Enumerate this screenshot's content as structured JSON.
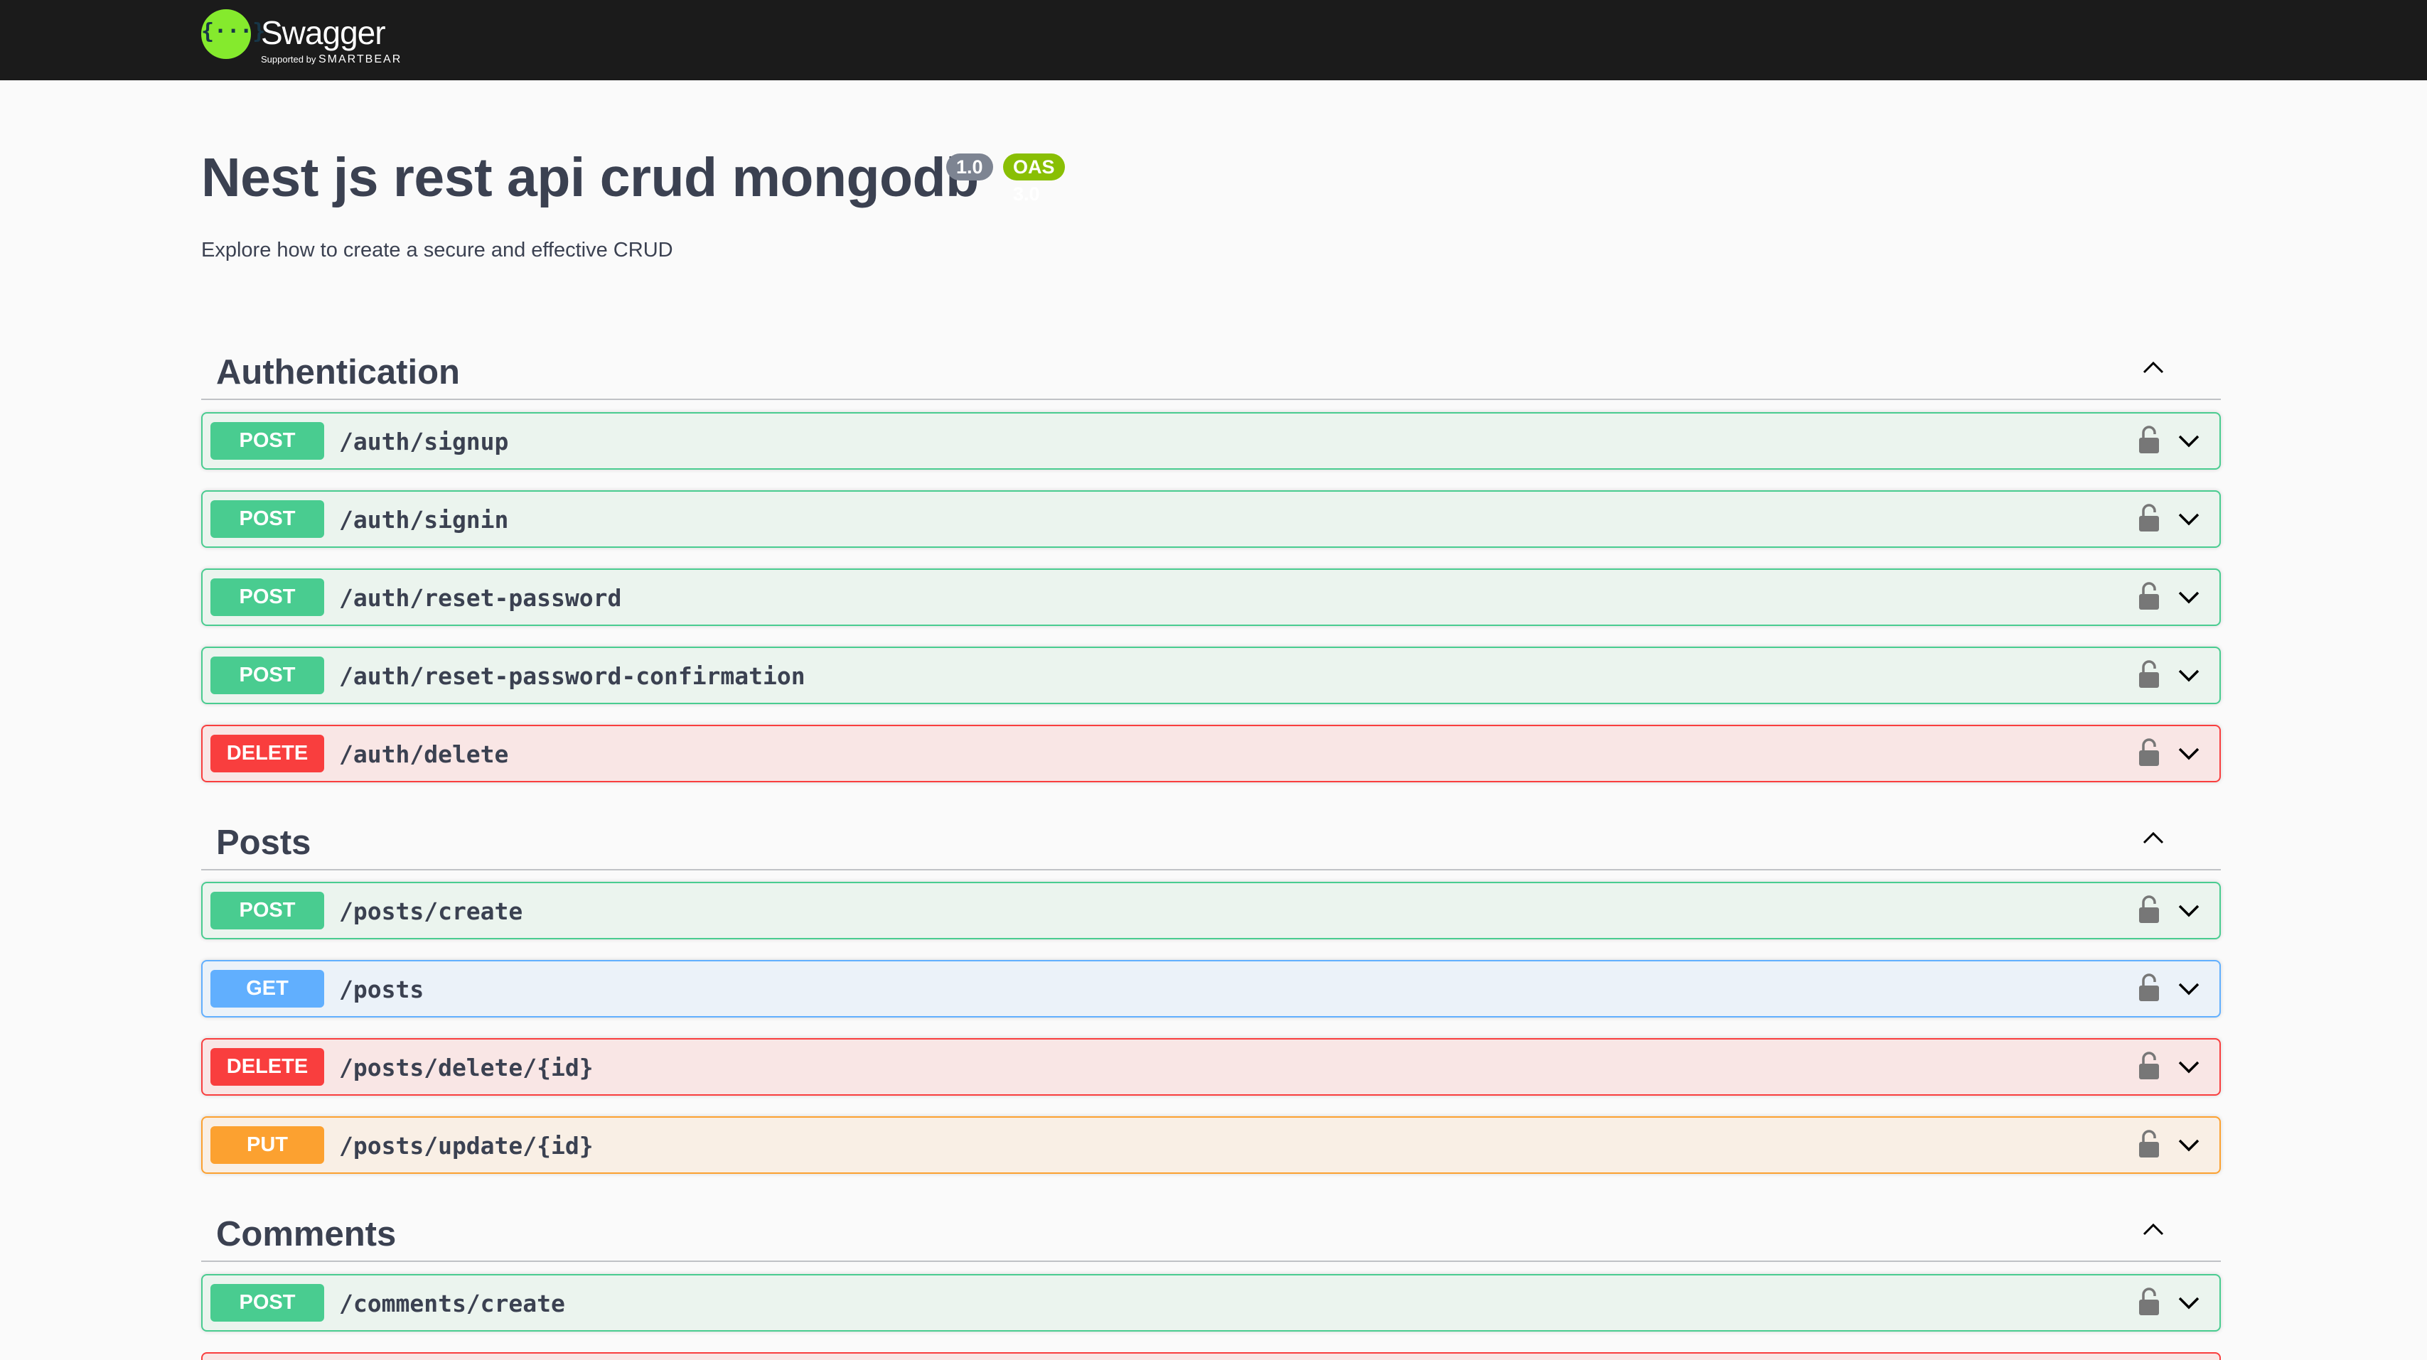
{
  "topbar": {
    "logo_symbol": "{···}",
    "brand": "Swagger",
    "supported_by": "Supported by",
    "sponsor": "SMARTBEAR"
  },
  "info": {
    "title": "Nest js rest api crud mongodb",
    "version": "1.0",
    "oas": "OAS 3.0",
    "description": "Explore how to create a secure and effective CRUD"
  },
  "tags": [
    {
      "name": "Authentication",
      "operations": [
        {
          "method": "POST",
          "path": "/auth/signup"
        },
        {
          "method": "POST",
          "path": "/auth/signin"
        },
        {
          "method": "POST",
          "path": "/auth/reset-password"
        },
        {
          "method": "POST",
          "path": "/auth/reset-password-confirmation"
        },
        {
          "method": "DELETE",
          "path": "/auth/delete"
        }
      ]
    },
    {
      "name": "Posts",
      "operations": [
        {
          "method": "POST",
          "path": "/posts/create"
        },
        {
          "method": "GET",
          "path": "/posts"
        },
        {
          "method": "DELETE",
          "path": "/posts/delete/{id}"
        },
        {
          "method": "PUT",
          "path": "/posts/update/{id}"
        }
      ]
    },
    {
      "name": "Comments",
      "operations": [
        {
          "method": "POST",
          "path": "/comments/create"
        }
      ]
    }
  ],
  "colors": {
    "post": "#49cc90",
    "get": "#61affe",
    "delete": "#f93e3e",
    "put": "#fca130",
    "topbar": "#1b1b1b",
    "logo": "#85ea2d"
  },
  "icons": {
    "collapse": "chevron-up-icon",
    "lock": "lock-icon",
    "expand": "chevron-down-icon"
  }
}
